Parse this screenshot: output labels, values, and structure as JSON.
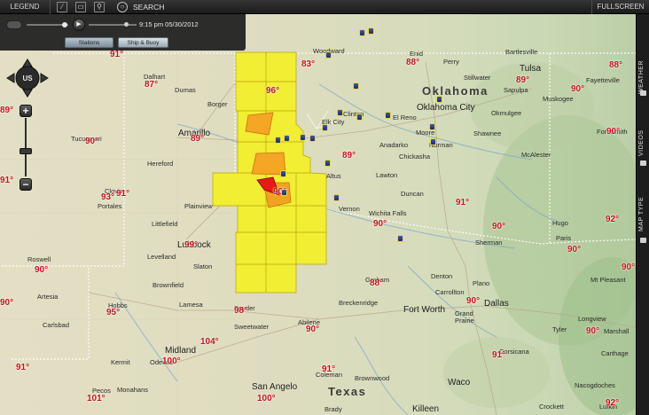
{
  "toolbar": {
    "legend_label": "LEGEND",
    "search_label": "SEARCH",
    "fullscreen_label": "FULLSCREEN"
  },
  "player": {
    "timestamp": "9:15 pm   05/30/2012",
    "tabs": [
      {
        "label": "Stations",
        "active": true
      },
      {
        "label": "Ship & Buoy",
        "active": false
      }
    ]
  },
  "rail": {
    "tabs": [
      "WEATHER",
      "VIDEOS",
      "MAP TYPE"
    ]
  },
  "map_controls": {
    "region_button": "US",
    "zoom_in": "+",
    "zoom_out": "−"
  },
  "map": {
    "states": [
      {
        "name": "Oklahoma"
      },
      {
        "name": "Texas"
      }
    ],
    "cities": [
      "Woodward",
      "Bartlesville",
      "Enid",
      "Perry",
      "Tulsa",
      "Fayetteville",
      "Dalhart",
      "Dumas",
      "Stillwater",
      "Sapulpa",
      "Muskogee",
      "Okmulgee",
      "Borger",
      "Amarillo",
      "Tucumcari",
      "Elk City",
      "Clinton",
      "El Reno",
      "Oklahoma City",
      "Shawnee",
      "Moore",
      "Norman",
      "Fort Smith",
      "Hereford",
      "Anadarko",
      "Chickasha",
      "McAlester",
      "Clovis",
      "Portales",
      "Plainview",
      "Altus",
      "Lawton",
      "Duncan",
      "Vernon",
      "Wichita Falls",
      "Hugo",
      "Littlefield",
      "Lubbock",
      "Sherman",
      "Paris",
      "Roswell",
      "Levelland",
      "Slaton",
      "Brownfield",
      "Graham",
      "Denton",
      "Mt Pleasant",
      "Artesia",
      "Hobbs",
      "Lamesa",
      "Snyder",
      "Breckenridge",
      "Carrollton",
      "Plano",
      "Fort Worth",
      "Dallas",
      "Grand Prairie",
      "Carlsbad",
      "Sweetwater",
      "Longview",
      "Marshall",
      "Abilene",
      "Tyler",
      "Midland",
      "Odessa",
      "Kermit",
      "Coleman",
      "Brownwood",
      "Corsicana",
      "Carthage",
      "Pecos",
      "Monahans",
      "San Angelo",
      "Waco",
      "Nacogdoches",
      "Brady",
      "Killeen",
      "Crockett",
      "Lufkin"
    ],
    "temperatures": [
      "91°",
      "87°",
      "83°",
      "88°",
      "88°",
      "89°",
      "90°",
      "96°",
      "89°",
      "89°",
      "90°",
      "90°",
      "89°",
      "91°",
      "91°",
      "90°",
      "90°",
      "91°",
      "90°",
      "92°",
      "93°",
      "90°",
      "90°",
      "99°",
      "104°",
      "98°",
      "90°",
      "88°",
      "90°",
      "95°",
      "90°",
      "90°",
      "91°",
      "91°",
      "101°",
      "100°",
      "91°",
      "92°",
      "90°",
      "100°"
    ]
  }
}
